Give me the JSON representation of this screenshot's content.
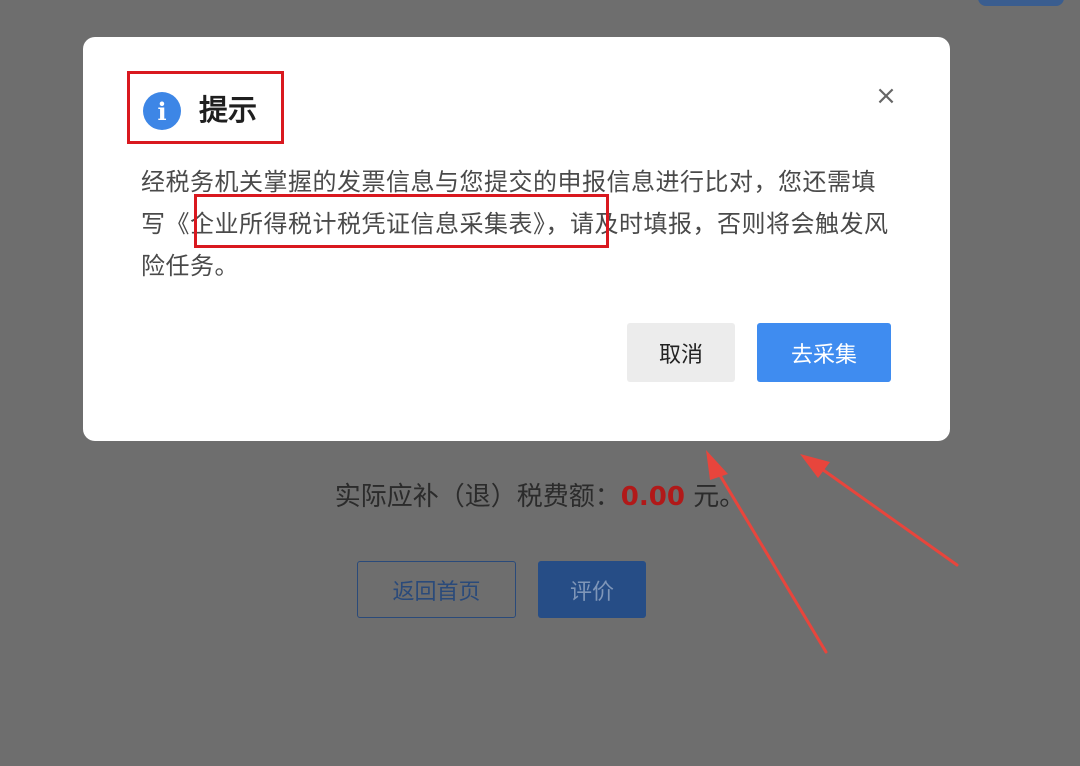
{
  "background": {
    "summary_label": "实际应补（退）税费额：",
    "summary_amount": "0.00",
    "summary_unit": " 元。",
    "home_button_label": "返回首页",
    "rate_button_label": "评价"
  },
  "dialog": {
    "title": "提示",
    "info_icon": "info-icon",
    "close_icon": "close-icon",
    "close_glyph": "×",
    "message_part1": "经税务机关掌握的发票信息与您提交的申报信息进行比对，您还需填写",
    "message_form_name": "《企业所得税计税凭证信息采集表》",
    "message_part2": "，请及时填报，否则将会触发风险任务。",
    "cancel_label": "取消",
    "collect_label": "去采集"
  },
  "colors": {
    "highlight": "#d9181f",
    "primary": "#3f8cf0",
    "amount": "#b11919"
  }
}
